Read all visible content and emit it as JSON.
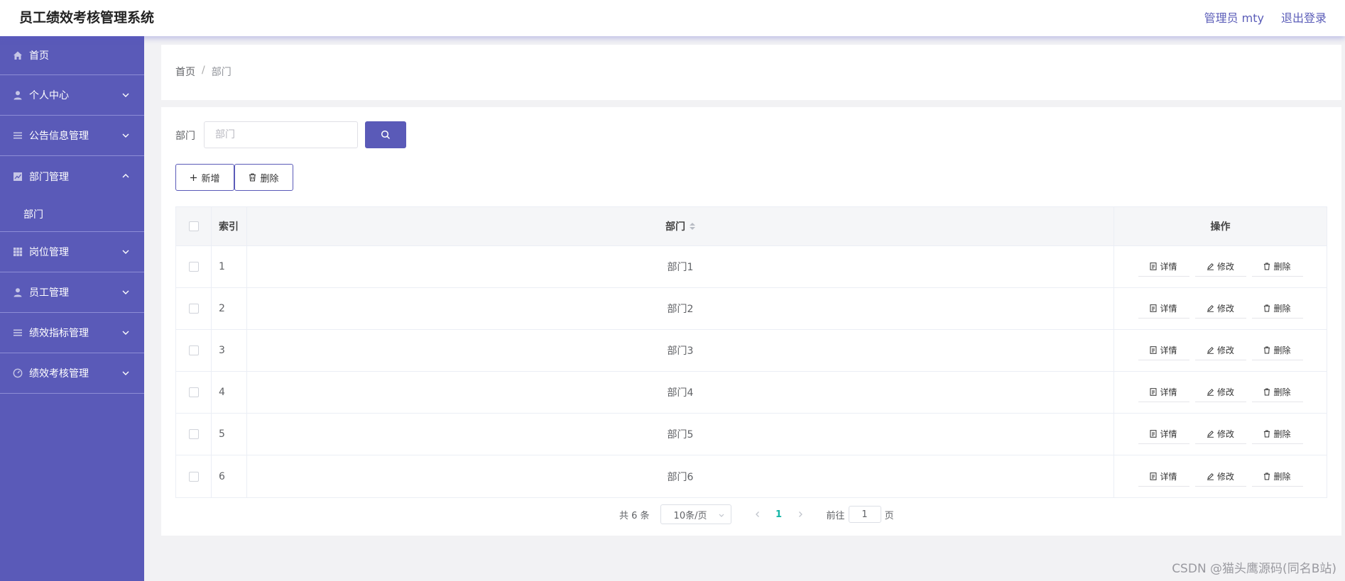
{
  "header": {
    "title": "员工绩效考核管理系统",
    "user": "管理员 mty",
    "logout": "退出登录"
  },
  "sidebar": {
    "items": [
      {
        "label": "首页",
        "icon": "home-icon"
      },
      {
        "label": "个人中心",
        "icon": "user-icon"
      },
      {
        "label": "公告信息管理",
        "icon": "list-icon"
      },
      {
        "label": "部门管理",
        "icon": "chart-icon"
      },
      {
        "label": "岗位管理",
        "icon": "grid-icon"
      },
      {
        "label": "员工管理",
        "icon": "user-icon"
      },
      {
        "label": "绩效指标管理",
        "icon": "list-icon"
      },
      {
        "label": "绩效考核管理",
        "icon": "gauge-icon"
      }
    ],
    "subitem": "部门"
  },
  "breadcrumb": {
    "home": "首页",
    "sep": "/",
    "current": "部门"
  },
  "search": {
    "label": "部门",
    "placeholder": "部门"
  },
  "toolbar": {
    "add_label": "新增",
    "delete_label": "删除"
  },
  "table": {
    "headers": {
      "index": "索引",
      "dept": "部门",
      "ops": "操作"
    },
    "ops": {
      "detail": "详情",
      "edit": "修改",
      "delete": "删除"
    },
    "rows": [
      {
        "index": "1",
        "dept": "部门1"
      },
      {
        "index": "2",
        "dept": "部门2"
      },
      {
        "index": "3",
        "dept": "部门3"
      },
      {
        "index": "4",
        "dept": "部门4"
      },
      {
        "index": "5",
        "dept": "部门5"
      },
      {
        "index": "6",
        "dept": "部门6"
      }
    ]
  },
  "pagination": {
    "total": "共 6 条",
    "page_size": "10条/页",
    "current_page": "1",
    "goto_prefix": "前往",
    "goto_value": "1",
    "goto_suffix": "页"
  },
  "watermark": "CSDN @猫头鹰源码(同名B站)",
  "colors": {
    "accent": "#5a5ab8",
    "active_page": "#13b5a6"
  }
}
